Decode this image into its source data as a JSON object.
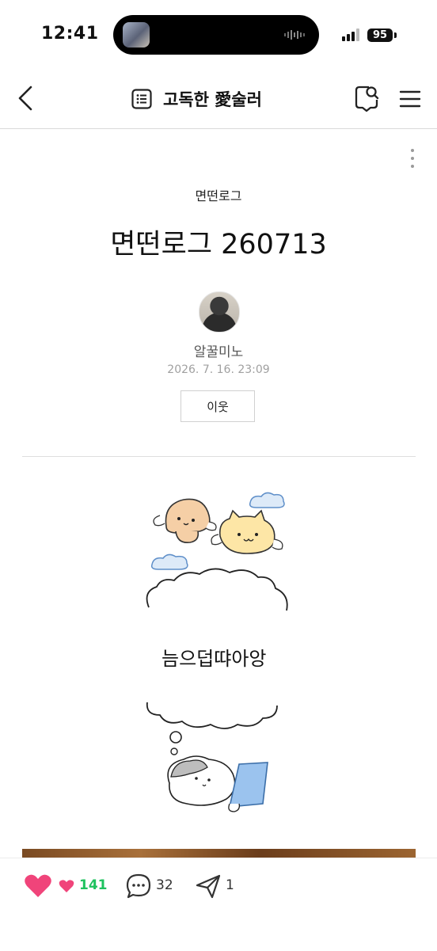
{
  "status_bar": {
    "time": "12:41",
    "battery": "95"
  },
  "nav": {
    "blog_title": "고독한 愛술러",
    "icons": {
      "back": "chevron-left-icon",
      "list": "list-icon",
      "search": "search-icon",
      "menu": "hamburger-icon"
    }
  },
  "post": {
    "category": "면떤로그",
    "title": "면떤로그 260713",
    "author": "알꿀미노",
    "date": "2026. 7. 16. 23:09",
    "neighbor_button": "이웃",
    "drawing_text": "늠으덥땨아앙"
  },
  "actions": {
    "like_count": "141",
    "comment_count": "32",
    "share_count": "1"
  },
  "colors": {
    "like": "#f0447a",
    "like_count": "#1fc25f"
  }
}
